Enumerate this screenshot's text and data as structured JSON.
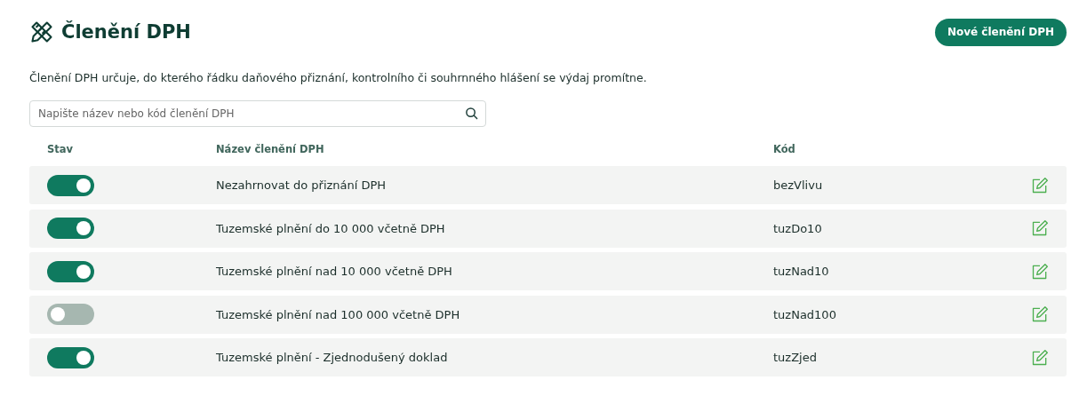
{
  "header": {
    "title": "Členění DPH",
    "new_button": "Nové členění DPH"
  },
  "description": "Členění DPH určuje, do kterého řádku daňového přiznání, kontrolního či souhrnného hlášení se výdaj promítne.",
  "search": {
    "placeholder": "Napište název nebo kód členění DPH"
  },
  "table": {
    "columns": [
      "Stav",
      "Název členění DPH",
      "Kód"
    ],
    "rows": [
      {
        "on": true,
        "name": "Nezahrnovat do přiznání DPH",
        "code": "bezVlivu"
      },
      {
        "on": true,
        "name": "Tuzemské plnění do 10 000 včetně DPH",
        "code": "tuzDo10"
      },
      {
        "on": true,
        "name": "Tuzemské plnění nad 10 000 včetně DPH",
        "code": "tuzNad10"
      },
      {
        "on": false,
        "name": "Tuzemské plnění nad 100 000 včetně DPH",
        "code": "tuzNad100"
      },
      {
        "on": true,
        "name": "Tuzemské plnění - Zjednodušený doklad",
        "code": "tuzZjed"
      }
    ]
  }
}
